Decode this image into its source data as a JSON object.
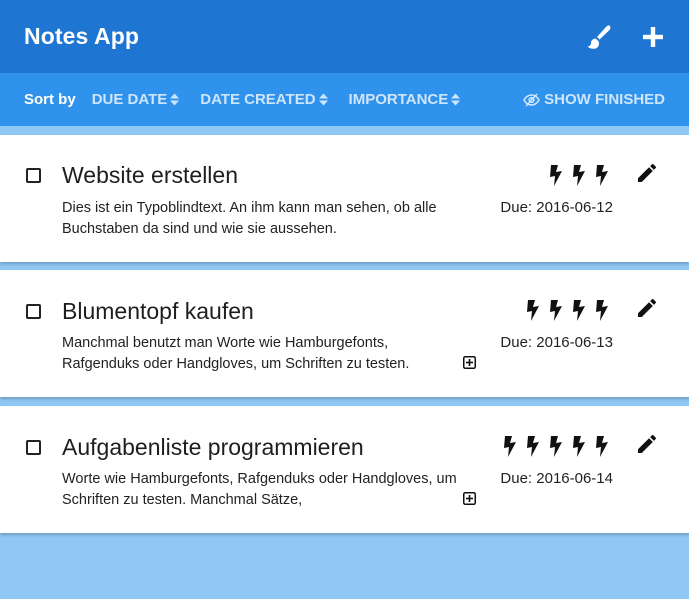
{
  "header": {
    "title": "Notes App",
    "icons": [
      "paintbrush-icon",
      "plus-icon"
    ]
  },
  "sortbar": {
    "label": "Sort by",
    "options": [
      "DUE DATE",
      "DATE CREATED",
      "IMPORTANCE"
    ],
    "show_finished": "SHOW FINISHED"
  },
  "notes": [
    {
      "title": "Website erstellen",
      "description": "Dies ist ein Typoblindtext. An ihm kann man sehen, ob alle Buchstaben da sind und wie sie aussehen.",
      "due": "Due: 2016-06-12",
      "importance": 3,
      "checked": false
    },
    {
      "title": "Blumentopf kaufen",
      "description": "Manchmal benutzt man Worte wie Hamburgefonts, Rafgenduks oder Handgloves, um Schriften zu testen.",
      "due": "Due: 2016-06-13",
      "importance": 4,
      "checked": false
    },
    {
      "title": "Aufgabenliste programmieren",
      "description": "Worte wie Hamburgefonts, Rafgenduks oder Handgloves, um Schriften zu testen. Manchmal Sätze,",
      "due": "Due: 2016-06-14",
      "importance": 5,
      "checked": false
    }
  ],
  "colors": {
    "header": "#1e76d2",
    "sortbar": "#2f93ee",
    "background": "#90c8f5",
    "card": "#ffffff"
  }
}
